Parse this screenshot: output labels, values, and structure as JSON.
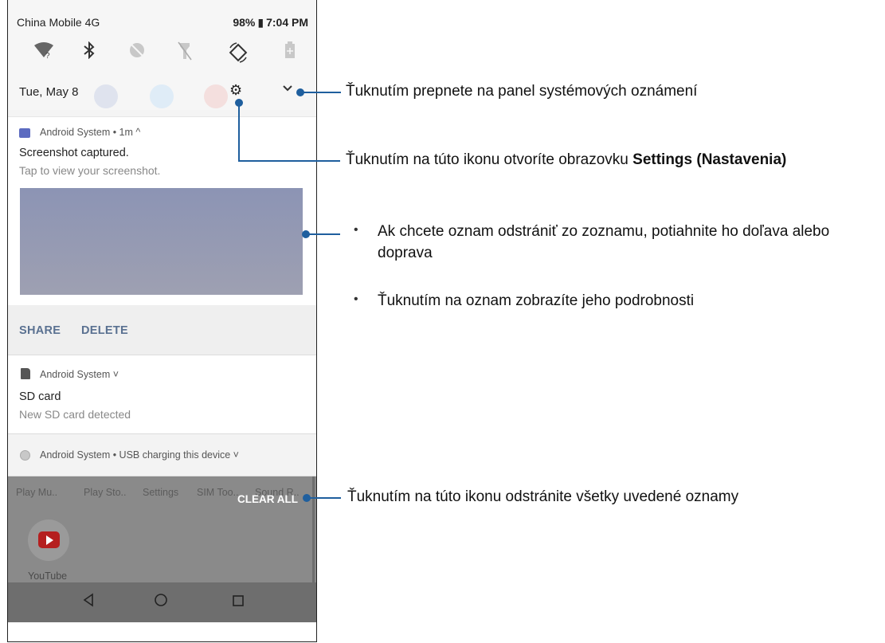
{
  "status_bar": {
    "carrier": "China Mobile 4G",
    "battery_percent": "98%",
    "time": "7:04 PM"
  },
  "quick_settings": {
    "icons": [
      "wifi-unknown-icon",
      "bluetooth-icon",
      "do-not-disturb-off-icon",
      "flashlight-off-icon",
      "auto-rotate-icon",
      "battery-saver-icon"
    ]
  },
  "header_row": {
    "date": "Tue, May 8"
  },
  "notification_1": {
    "app_line": "Android System • 1m ^",
    "title": "Screenshot captured.",
    "subtitle": "Tap to view your screenshot.",
    "actions": [
      "SHARE",
      "DELETE"
    ]
  },
  "notification_2": {
    "app_line": "Android System ˅",
    "title": "SD card",
    "subtitle": "New SD card detected"
  },
  "notification_3": {
    "app_line": "Android System • USB charging this device ˅"
  },
  "home_background": {
    "app_labels": [
      "Play Mu..",
      "Play Sto..",
      "Settings",
      "SIM Too..",
      "Sound R.."
    ],
    "clear_all": "CLEAR ALL",
    "youtube_label": "YouTube"
  },
  "callouts": {
    "expand": "Ťuknutím prepnete na panel systémových oznámení",
    "settings_prefix": "Ťuknutím na túto ikonu otvoríte obrazovku ",
    "settings_bold": "Settings (Nastavenia)",
    "bullet_1": "Ak chcete oznam odstrániť zo zoznamu, potiahnite ho doľava alebo doprava",
    "bullet_2": "Ťuknutím na oznam zobrazíte jeho podrobnosti",
    "clear_all": "Ťuknutím na túto ikonu odstránite všetky uvedené oznamy"
  },
  "colors": {
    "callout_blue": "#1f5f9e",
    "action_text": "#5a7191",
    "youtube_red": "#b51f1f"
  }
}
